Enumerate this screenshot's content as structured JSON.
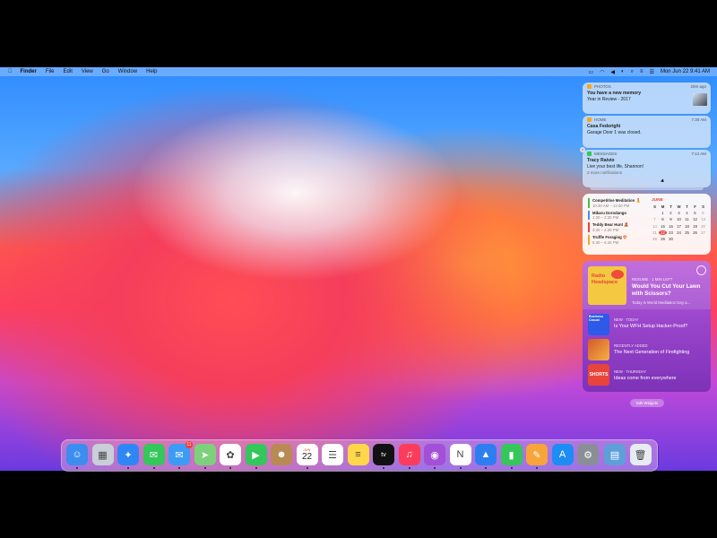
{
  "menubar": {
    "apple_icon": "apple-logo",
    "items": [
      "Finder",
      "File",
      "Edit",
      "View",
      "Go",
      "Window",
      "Help"
    ],
    "status_icons": [
      "airplay-icon",
      "wifi-icon",
      "volume-icon",
      "siri-icon",
      "search-icon",
      "control-center-icon",
      "notification-icon"
    ],
    "datetime": "Mon Jun 22  9:41 AM"
  },
  "notifications": [
    {
      "app": "PHOTOS",
      "time": "20m ago",
      "title": "You have a new memory",
      "body": "Year in Review - 2017",
      "more": "",
      "color": "#f5a623"
    },
    {
      "app": "HOME",
      "time": "7:30 AM",
      "title": "Casa Federighi",
      "body": "Garage Door 1 was closed.",
      "more": "",
      "color": "#f5a623"
    },
    {
      "app": "MESSAGES",
      "time": "7:14 AM",
      "title": "Tracy Raivio",
      "body": "Live your best life, Shannon!",
      "more": "3 more notifications",
      "color": "#34c759"
    }
  ],
  "calendar": {
    "month": "JUNE",
    "days_of_week": [
      "S",
      "M",
      "T",
      "W",
      "T",
      "F",
      "S"
    ],
    "weeks": [
      [
        "",
        "1",
        "2",
        "3",
        "4",
        "5",
        "6"
      ],
      [
        "7",
        "8",
        "9",
        "10",
        "11",
        "12",
        "13"
      ],
      [
        "14",
        "15",
        "16",
        "17",
        "18",
        "19",
        "20"
      ],
      [
        "21",
        "22",
        "23",
        "24",
        "25",
        "26",
        "27"
      ],
      [
        "28",
        "29",
        "30",
        "",
        "",
        "",
        ""
      ]
    ],
    "today": "22",
    "events": [
      {
        "name": "Competitive Meditation 🧘",
        "time": "10:30 AM – 12:30 PM",
        "color": "#4cbb4c"
      },
      {
        "name": "Mikaru Dorodango",
        "time": "1:30 – 2:30 PM",
        "color": "#4a90e2"
      },
      {
        "name": "Teddy Bear Hunt 🧸",
        "time": "3:30 – 4:30 PM",
        "color": "#e8443a"
      },
      {
        "name": "Truffle Foraging 🍄",
        "time": "5:30 – 6:45 PM",
        "color": "#f5a623"
      }
    ]
  },
  "podcasts": {
    "featured": {
      "art_title": "Radio Headspace",
      "label": "RESUME · 1 MIN LEFT",
      "title": "Would You Cut Your Lawn with Scissors?",
      "subtitle": "Today is World Meditation Day a..."
    },
    "rows": [
      {
        "art": "Business Casual",
        "label": "NEW · TODAY",
        "title": "Is Your WFH Setup Hacker-Proof?"
      },
      {
        "art": "",
        "label": "RECENTLY ADDED",
        "title": "The Next Generation of Firefighting"
      },
      {
        "art": "SHORTS",
        "label": "NEW · THURSDAY",
        "title": "Ideas come from everywhere"
      }
    ]
  },
  "edit_widgets_label": "Edit Widgets",
  "dock": {
    "calendar_month": "JUN",
    "calendar_day": "22",
    "mail_badge": "11",
    "apps": [
      {
        "name": "finder-icon",
        "color": "#3b8df0",
        "glyph": "☺"
      },
      {
        "name": "launchpad-icon",
        "color": "#c9cfd8",
        "glyph": "▦"
      },
      {
        "name": "safari-icon",
        "color": "#2f86f6",
        "glyph": "✦"
      },
      {
        "name": "messages-icon",
        "color": "#34c759",
        "glyph": "✉"
      },
      {
        "name": "mail-icon",
        "color": "#3c9cf5",
        "glyph": "✉"
      },
      {
        "name": "maps-icon",
        "color": "#7ed17b",
        "glyph": "➤"
      },
      {
        "name": "photos-icon",
        "color": "#ffffff",
        "glyph": "✿"
      },
      {
        "name": "facetime-icon",
        "color": "#34c759",
        "glyph": "▶"
      },
      {
        "name": "contacts-icon",
        "color": "#b88a54",
        "glyph": "☻"
      },
      {
        "name": "calendar-icon",
        "color": "#ffffff",
        "glyph": ""
      },
      {
        "name": "reminders-icon",
        "color": "#ffffff",
        "glyph": "☰"
      },
      {
        "name": "notes-icon",
        "color": "#ffd84a",
        "glyph": "≡"
      },
      {
        "name": "apple-tv-icon",
        "color": "#111111",
        "glyph": "tv"
      },
      {
        "name": "music-icon",
        "color": "#fc3c5a",
        "glyph": "♫"
      },
      {
        "name": "podcasts-icon",
        "color": "#a44fd8",
        "glyph": "◉"
      },
      {
        "name": "news-icon",
        "color": "#ffffff",
        "glyph": "N"
      },
      {
        "name": "keynote-icon",
        "color": "#2d7ff0",
        "glyph": "▲"
      },
      {
        "name": "numbers-icon",
        "color": "#34c759",
        "glyph": "▮"
      },
      {
        "name": "pages-icon",
        "color": "#f7a43b",
        "glyph": "✎"
      },
      {
        "name": "app-store-icon",
        "color": "#1e8cf5",
        "glyph": "A"
      },
      {
        "name": "system-preferences-icon",
        "color": "#8a8f96",
        "glyph": "⚙"
      },
      {
        "name": "downloads-stack-icon",
        "color": "#5da0d8",
        "glyph": "▤"
      },
      {
        "name": "trash-icon",
        "color": "#e6ecf2",
        "glyph": "🗑"
      }
    ]
  }
}
